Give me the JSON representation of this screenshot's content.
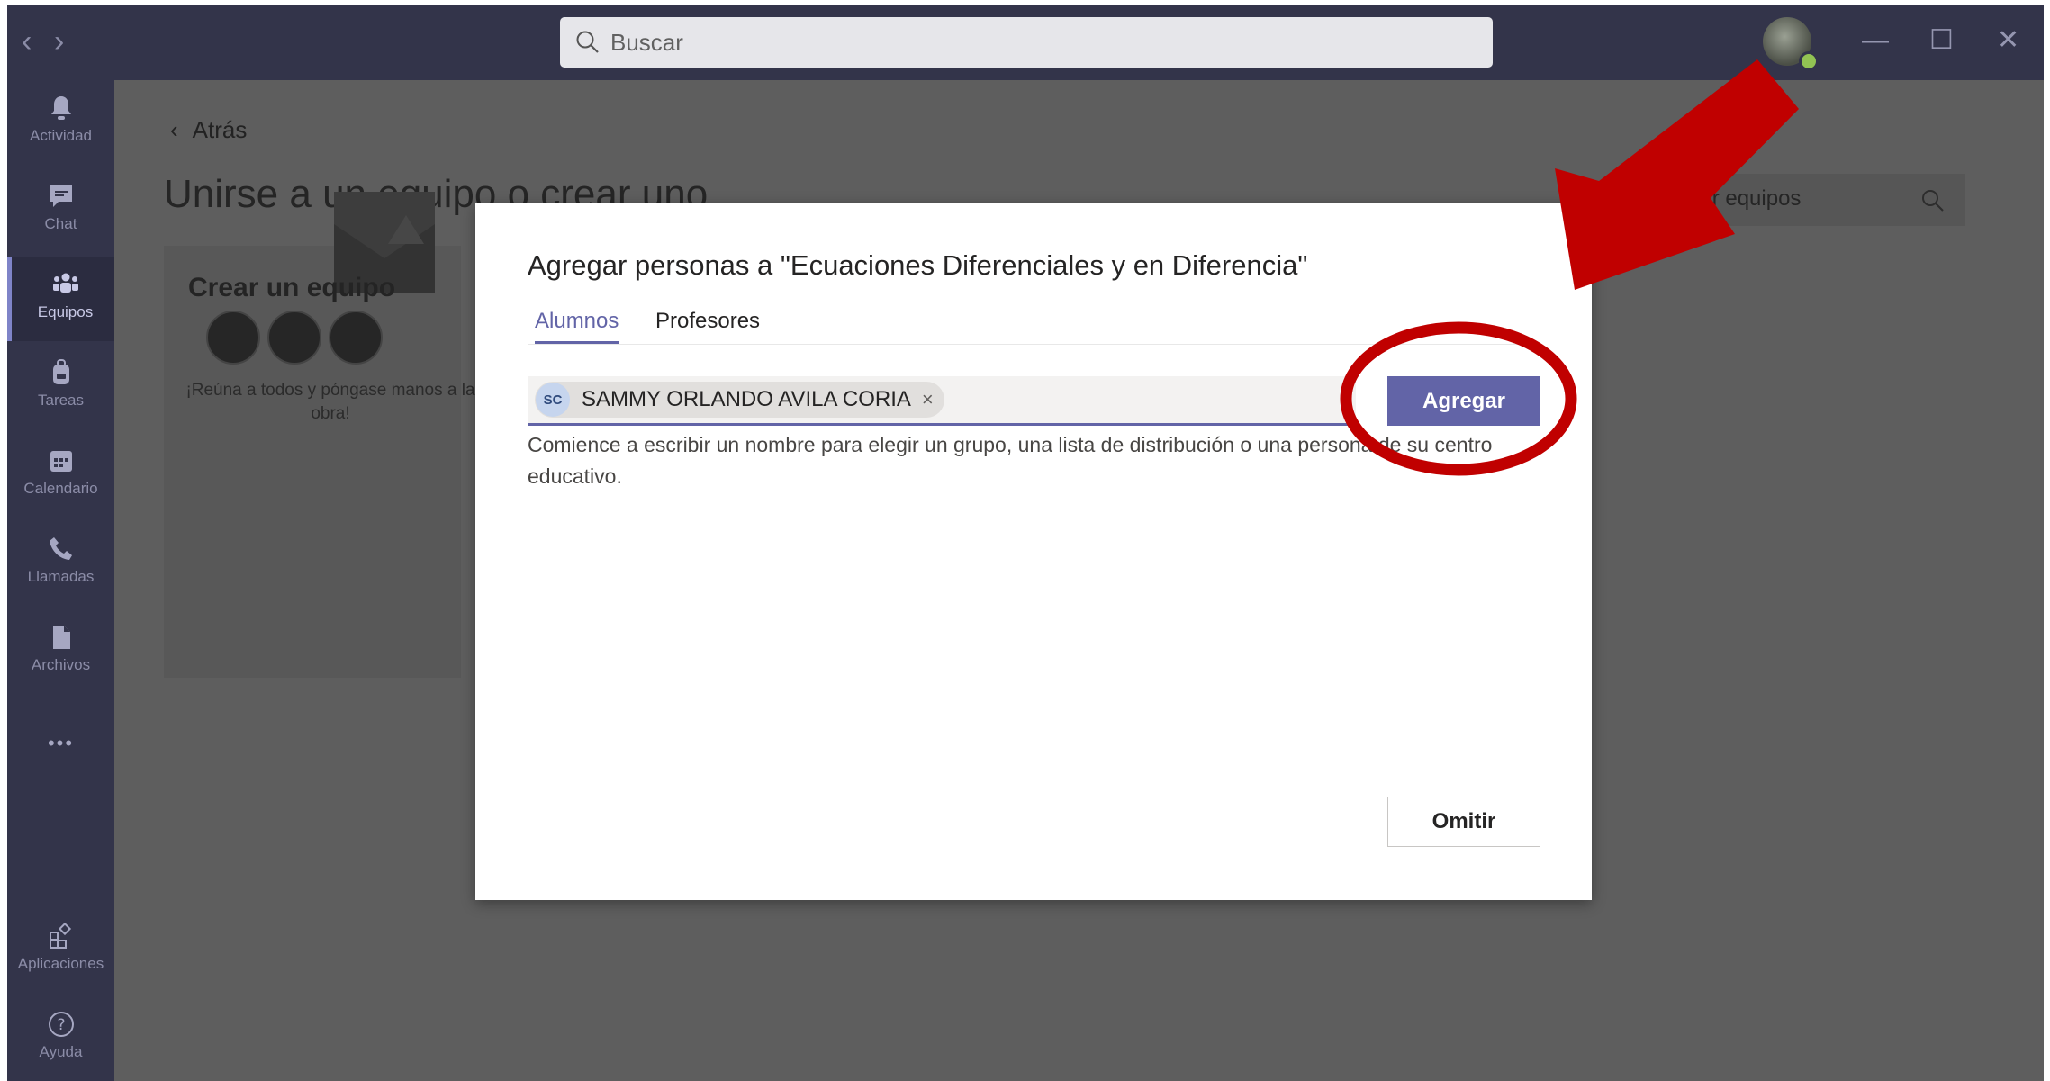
{
  "titlebar": {
    "search_placeholder": "Buscar",
    "back_icon": "chevron-left-icon",
    "forward_icon": "chevron-right-icon",
    "window_controls": [
      "minimize-icon",
      "maximize-icon",
      "close-icon"
    ]
  },
  "rail": {
    "items": [
      {
        "label": "Actividad",
        "icon": "bell-icon"
      },
      {
        "label": "Chat",
        "icon": "chat-icon"
      },
      {
        "label": "Equipos",
        "icon": "teams-icon",
        "active": true
      },
      {
        "label": "Tareas",
        "icon": "backpack-icon"
      },
      {
        "label": "Calendario",
        "icon": "calendar-icon"
      },
      {
        "label": "Llamadas",
        "icon": "phone-icon"
      },
      {
        "label": "Archivos",
        "icon": "file-icon"
      }
    ],
    "more_label": "•••",
    "bottom_items": [
      {
        "label": "Aplicaciones",
        "icon": "apps-icon"
      },
      {
        "label": "Ayuda",
        "icon": "help-icon"
      }
    ]
  },
  "main": {
    "back_label": "Atrás",
    "page_title": "Unirse a un equipo o crear uno",
    "team_search_text": "Buscar equipos",
    "card": {
      "title": "Crear un equipo",
      "description": "¡Reúna a todos y póngase manos a la obra!"
    }
  },
  "dialog": {
    "title": "Agregar personas a \"Ecuaciones Diferenciales y en Diferencia\"",
    "tabs": [
      "Alumnos",
      "Profesores"
    ],
    "selected_person": {
      "initials": "SC",
      "name": "SAMMY ORLANDO AVILA CORIA",
      "remove_glyph": "×"
    },
    "add_button": "Agregar",
    "hint": "Comience a escribir un nombre para elegir un grupo, una lista de distribución o una persona de su centro educativo.",
    "skip_button": "Omitir"
  },
  "colors": {
    "accent": "#6264a7",
    "rail": "#33344a",
    "annotation_red": "#c00000"
  }
}
